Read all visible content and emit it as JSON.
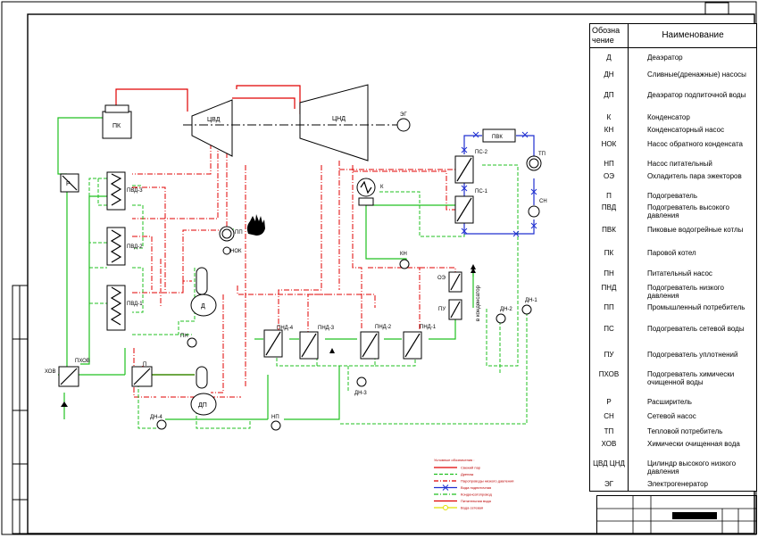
{
  "legend_table": {
    "header_code": "Обозна чение",
    "header_name": "Наименование",
    "rows": [
      {
        "code": "Д",
        "name": "Деаэратор"
      },
      {
        "code": "ДН",
        "name": "Сливные(дренажные) насосы"
      },
      {
        "code": "ДП",
        "name": "Деаэратор подпиточной воды"
      },
      {
        "code": "К",
        "name": "Конденсатор"
      },
      {
        "code": "КН",
        "name": "Конденсаторный насос"
      },
      {
        "code": "НОК",
        "name": "Насос обратного конденсата"
      },
      {
        "code": "НП",
        "name": "Насос питательный"
      },
      {
        "code": "ОЭ",
        "name": "Охладитель пара эжекторов"
      },
      {
        "code": "П",
        "name": "Подогреватель"
      },
      {
        "code": "ПВД",
        "name": "Подогреватель высокого давления"
      },
      {
        "code": "ПВК",
        "name": "Пиковые водогрейные котлы"
      },
      {
        "code": "ПК",
        "name": "Паровой котел"
      },
      {
        "code": "ПН",
        "name": "Питательный насос"
      },
      {
        "code": "ПНД",
        "name": "Подогреватель низкого давления"
      },
      {
        "code": "ПП",
        "name": "Промышленный потребитель"
      },
      {
        "code": "ПС",
        "name": "Подогреватель сетевой воды"
      },
      {
        "code": "ПУ",
        "name": "Подогреватель уплотнений"
      },
      {
        "code": "ПХОВ",
        "name": "Подогреватель химически очищенной воды"
      },
      {
        "code": "Р",
        "name": "Расширитель"
      },
      {
        "code": "СН",
        "name": "Сетевой насос"
      },
      {
        "code": "ТП",
        "name": "Тепловой потребитель"
      },
      {
        "code": "ХОВ",
        "name": "Химически очищенная вода"
      },
      {
        "code": "ЦВД ЦНД",
        "name": "Цилиндр высокого низкого давления"
      },
      {
        "code": "ЭГ",
        "name": "Электрогенератор"
      }
    ]
  },
  "scheme": {
    "pk": "ПК",
    "r": "Р",
    "pvd3": "ПВД-3",
    "pvd2": "ПВД-2",
    "pvd1": "ПВД-1",
    "cvd": "ЦВД",
    "cnd": "ЦНД",
    "eg": "ЭГ",
    "pvk": "ПВК",
    "ps2": "ПС-2",
    "ps1": "ПС-1",
    "tp": "ТП",
    "sn": "СН",
    "k": "К",
    "kn": "КН",
    "pp": "ПП",
    "nok": "НОК",
    "d": "Д",
    "pn": "ПН",
    "oe": "ОЭ",
    "pu": "ПУ",
    "to_condenser": "в конденсатор",
    "dn2": "ДН-2",
    "dn1": "ДН-1",
    "pnd4": "ПНД-4",
    "pnd3": "ПНД-3",
    "pnd2": "ПНД-2",
    "pnd1": "ПНД-1",
    "dn3": "ДН-3",
    "hov": "ХОВ",
    "phov": "ПХОВ",
    "p": "П",
    "dp": "ДП",
    "dn4": "ДН-4",
    "np": "НП"
  },
  "line_legend": {
    "title": "Условные обозначения :",
    "items": [
      {
        "text": "Свежий пар",
        "color": "#e00000",
        "style": "solid"
      },
      {
        "text": "Дренаж",
        "color": "#20c020",
        "style": "dashed"
      },
      {
        "text": "Паропроводы низкого давления",
        "color": "#e00000",
        "style": "dashdot"
      },
      {
        "text": "Вода подпиточная",
        "color": "#2030d0",
        "style": "cross"
      },
      {
        "text": "Конденсатопровод",
        "color": "#20c020",
        "style": "dashdot"
      },
      {
        "text": "Питательная вода",
        "color": "#e00000",
        "style": "solid"
      },
      {
        "text": "Вода сетевая",
        "color": "#e0e000",
        "style": "circle"
      }
    ]
  },
  "colors": {
    "steam": "#e00000",
    "condensate": "#20c020",
    "network": "#2030d0",
    "frame": "#000000"
  }
}
